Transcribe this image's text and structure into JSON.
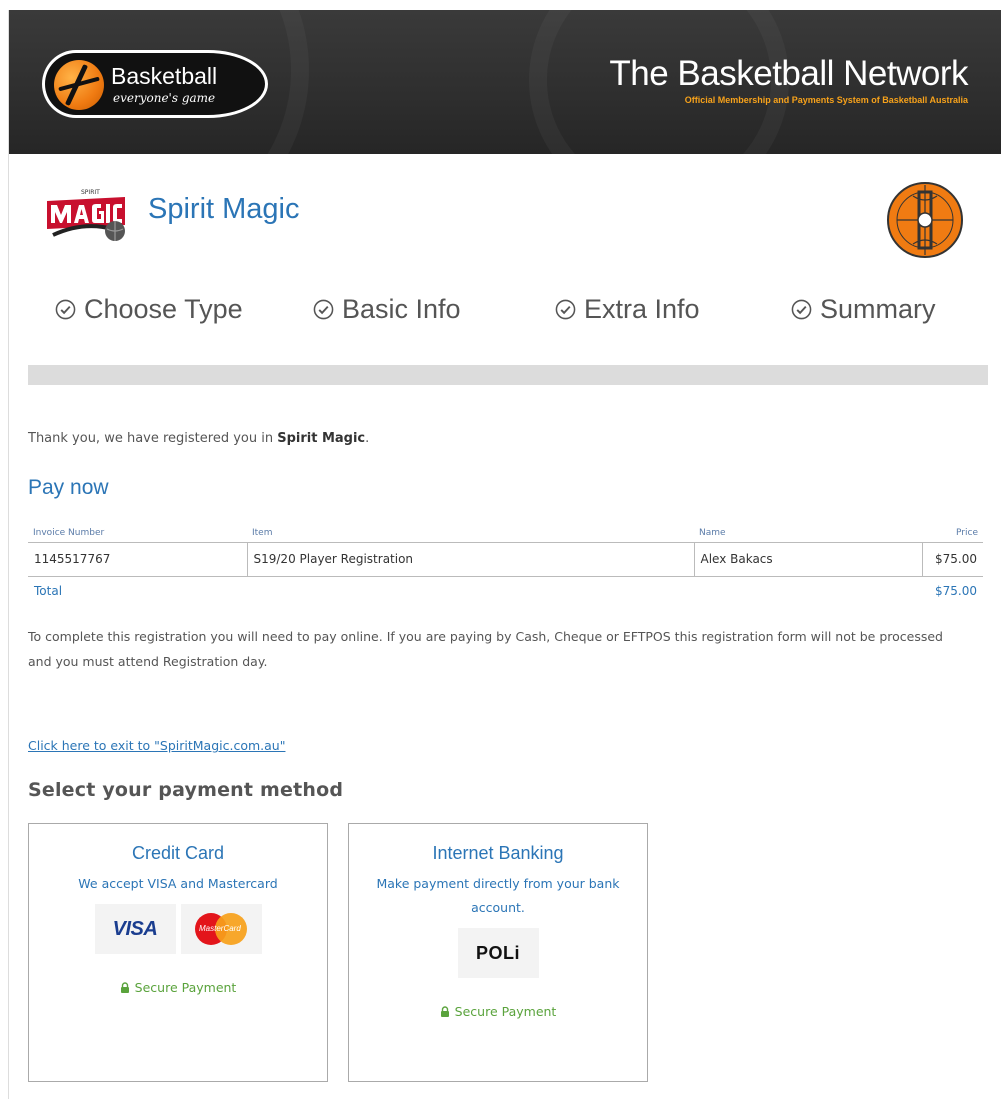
{
  "header": {
    "logo_word": "Basketball",
    "logo_tagline": "everyone's game",
    "network_title": "The Basketball Network",
    "network_subtitle": "Official Membership and Payments System of Basketball Australia"
  },
  "club": {
    "name": "Spirit Magic"
  },
  "steps": [
    {
      "label": "Choose Type"
    },
    {
      "label": "Basic Info"
    },
    {
      "label": "Extra Info"
    },
    {
      "label": "Summary"
    }
  ],
  "progress": {
    "percent": 100
  },
  "thanks": {
    "prefix": "Thank you, we have registered you in ",
    "club": "Spirit Magic",
    "suffix": "."
  },
  "pay_now_title": "Pay now",
  "invoice": {
    "headers": {
      "invoice_number": "Invoice Number",
      "item": "Item",
      "name": "Name",
      "price": "Price"
    },
    "rows": [
      {
        "invoice_number": "1145517767",
        "item": "S19/20 Player Registration",
        "name": "Alex Bakacs",
        "price": "$75.00"
      }
    ],
    "total_label": "Total",
    "total_value": "$75.00"
  },
  "notice": "To complete this registration you will need to pay online. If you are paying by Cash, Cheque or EFTPOS this registration form will not be processed and you must attend Registration day.",
  "exit_link": "Click here to exit to \"SpiritMagic.com.au\"",
  "payment": {
    "title": "Select your payment method",
    "credit_card": {
      "title": "Credit Card",
      "description": "We accept VISA and Mastercard",
      "visa": "VISA",
      "mastercard": "MasterCard",
      "secure": "Secure Payment"
    },
    "internet_banking": {
      "title": "Internet Banking",
      "description": "Make payment directly from your bank account.",
      "poli": "POLi",
      "secure": "Secure Payment"
    }
  },
  "colors": {
    "accent_blue": "#2b75b6",
    "secure_green": "#5aa33c",
    "header_dark": "#2e2e2e",
    "header_orange": "#f7a21b"
  }
}
